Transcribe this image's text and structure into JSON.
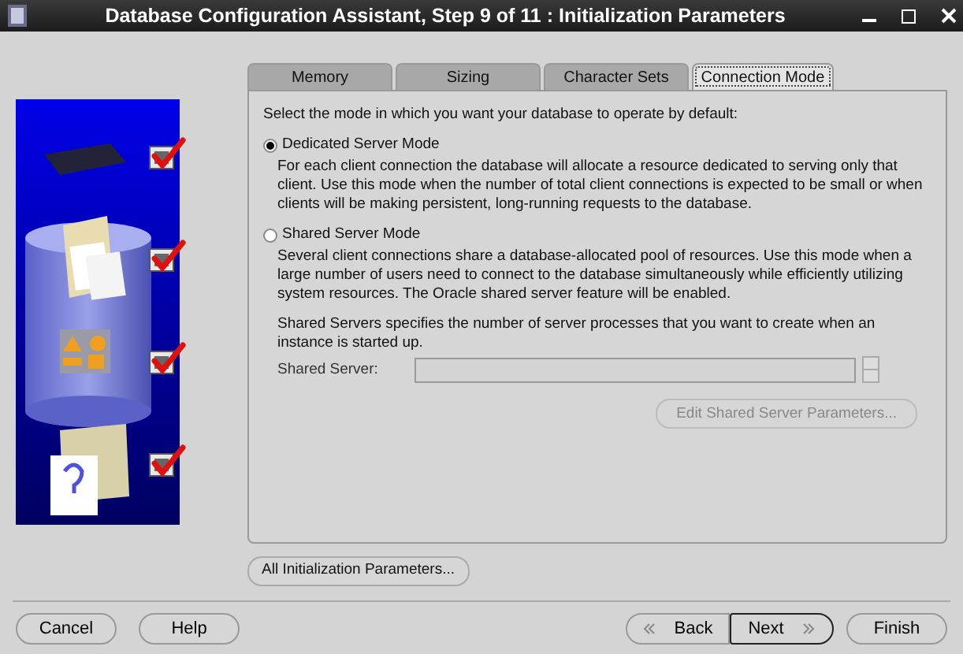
{
  "window": {
    "title": "Database Configuration Assistant, Step 9 of 11 : Initialization Parameters"
  },
  "steps": [
    {
      "checked": true
    },
    {
      "checked": true
    },
    {
      "checked": true
    },
    {
      "checked": true
    }
  ],
  "tabs": [
    {
      "label": "Memory",
      "selected": false
    },
    {
      "label": "Sizing",
      "selected": false
    },
    {
      "label": "Character Sets",
      "selected": false
    },
    {
      "label": "Connection Mode",
      "selected": true
    }
  ],
  "intro": "Select the mode in which you want your database to operate by default:",
  "modes": [
    {
      "label": "Dedicated Server Mode",
      "selected": true,
      "description": "For each client connection the database will allocate a resource dedicated to serving only that client.  Use this mode when the number of total client connections is expected to be small or when clients will be making persistent, long-running requests to the database."
    },
    {
      "label": "Shared Server Mode",
      "selected": false,
      "description": "Several client connections share a database-allocated pool of resources.  Use this mode when a large number of users need to connect to the database simultaneously while efficiently utilizing system resources.  The Oracle shared server feature will be enabled."
    }
  ],
  "shared_servers_note": "Shared Servers specifies the number of server processes that you want to create when an instance is started up.",
  "shared_server_field": {
    "label": "Shared Server:",
    "disabled": true
  },
  "edit_button": {
    "label": "Edit Shared Server Parameters...",
    "disabled": true
  },
  "all_params_button": "All Initialization Parameters...",
  "footer_buttons": [
    {
      "label": "Cancel",
      "kind": "plain"
    },
    {
      "label": "Help",
      "kind": "plain"
    },
    {
      "label": "Back",
      "kind": "back"
    },
    {
      "label": "Next",
      "kind": "next"
    },
    {
      "label": "Finish",
      "kind": "plain"
    }
  ]
}
